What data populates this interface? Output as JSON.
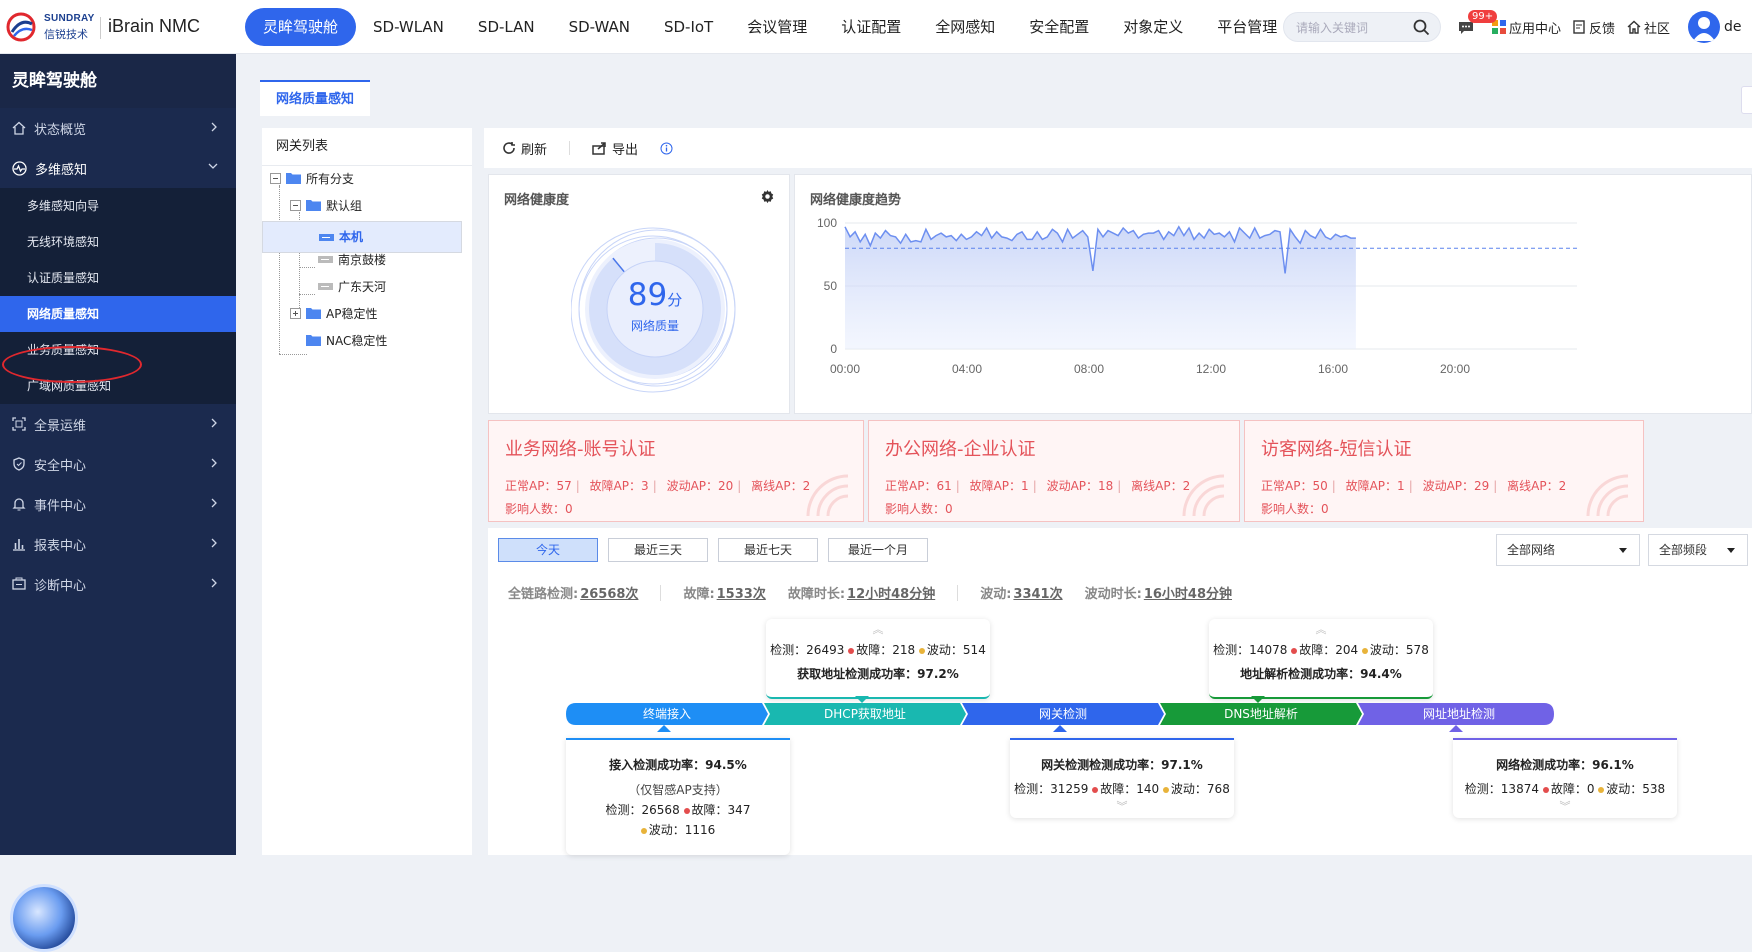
{
  "brand": {
    "en": "SUNDRAY",
    "cn": "信锐技术",
    "product": "iBrain NMC"
  },
  "nav": [
    "灵眸驾驶舱",
    "SD-WLAN",
    "SD-LAN",
    "SD-WAN",
    "SD-IoT",
    "会议管理",
    "认证配置",
    "全网感知",
    "安全配置",
    "对象定义",
    "平台管理"
  ],
  "search": {
    "placeholder": "请输入关键词"
  },
  "topright": {
    "badge": "99+",
    "app_center": "应用中心",
    "feedback": "反馈",
    "community": "社区",
    "user": "de"
  },
  "sidebar": {
    "title": "灵眸驾驶舱",
    "items": [
      {
        "label": "状态概览"
      },
      {
        "label": "多维感知",
        "subs": [
          "多维感知向导",
          "无线环境感知",
          "认证质量感知",
          "网络质量感知",
          "业务质量感知",
          "广域网质量感知"
        ]
      },
      {
        "label": "全景运维"
      },
      {
        "label": "安全中心"
      },
      {
        "label": "事件中心"
      },
      {
        "label": "报表中心"
      },
      {
        "label": "诊断中心"
      }
    ]
  },
  "tab": "网络质量感知",
  "tree": {
    "title": "网关列表",
    "nodes": [
      "所有分支",
      "默认组",
      "本机",
      "南京鼓楼",
      "广东天河",
      "AP稳定性",
      "NAC稳定性"
    ]
  },
  "toolbar": {
    "refresh": "刷新",
    "export": "导出"
  },
  "health": {
    "title": "网络健康度",
    "score": "89",
    "unit": "分",
    "label": "网络质量",
    "value": 89
  },
  "trend": {
    "title": "网络健康度趋势",
    "y_ticks": [
      "100",
      "50",
      "0"
    ],
    "x_ticks": [
      "00:00",
      "04:00",
      "08:00",
      "12:00",
      "16:00",
      "20:00"
    ]
  },
  "networks": [
    {
      "title": "业务网络-账号认证",
      "normal": "正常AP：57",
      "fault": "故障AP：3",
      "fluct": "波动AP：20",
      "offline": "离线AP：2",
      "affected": "影响人数：0"
    },
    {
      "title": "办公网络-企业认证",
      "normal": "正常AP：61",
      "fault": "故障AP：1",
      "fluct": "波动AP：18",
      "offline": "离线AP：2",
      "affected": "影响人数：0"
    },
    {
      "title": "访客网络-短信认证",
      "normal": "正常AP：50",
      "fault": "故障AP：1",
      "fluct": "波动AP：29",
      "offline": "离线AP：2",
      "affected": "影响人数：0"
    }
  ],
  "ranges": [
    "今天",
    "最近三天",
    "最近七天",
    "最近一个月"
  ],
  "filters": {
    "network": "全部网络",
    "band": "全部频段"
  },
  "summary": {
    "total_label": "全链路检测:",
    "total": "26568次",
    "fault_label": "故障:",
    "fault": "1533次",
    "fault_dur_label": "故障时长:",
    "fault_dur": "12小时48分钟",
    "fluct_label": "波动:",
    "fluct": "3341次",
    "fluct_dur_label": "波动时长:",
    "fluct_dur": "16小时48分钟"
  },
  "pipeline": [
    {
      "label": "终端接入",
      "color": "#1e8ef5"
    },
    {
      "label": "DHCP获取地址",
      "color": "#19b8b0"
    },
    {
      "label": "网关检测",
      "color": "#2f66ec"
    },
    {
      "label": "DNS地址解析",
      "color": "#179a39"
    },
    {
      "label": "网址地址检测",
      "color": "#7062e6"
    }
  ],
  "boxes": {
    "access": {
      "rate": "接入检测成功率：94.5%",
      "note": "（仅智感AP支持）",
      "detect": "检测：26568",
      "fault": "故障：347",
      "fluct": "波动：1116"
    },
    "dhcp": {
      "rate": "获取地址检测成功率：97.2%",
      "detect": "检测：26493",
      "fault": "故障：218",
      "fluct": "波动：514"
    },
    "gateway": {
      "rate": "网关检测检测成功率：97.1%",
      "detect": "检测：31259",
      "fault": "故障：140",
      "fluct": "波动：768"
    },
    "dns": {
      "rate": "地址解析检测成功率：94.4%",
      "detect": "检测：14078",
      "fault": "故障：204",
      "fluct": "波动：578"
    },
    "url": {
      "rate": "网络检测成功率：96.1%",
      "detect": "检测：13874",
      "fault": "故障：0",
      "fluct": "波动：538"
    }
  },
  "chart_data": {
    "type": "line",
    "title": "网络健康度趋势",
    "xlabel": "",
    "ylabel": "",
    "ylim": [
      0,
      100
    ],
    "x_ticks": [
      "00:00",
      "04:00",
      "08:00",
      "12:00",
      "16:00",
      "20:00"
    ],
    "threshold": 80,
    "series": [
      {
        "values": [
          97,
          89,
          93,
          85,
          91,
          82,
          92,
          88,
          94,
          90,
          89,
          84,
          91,
          85,
          86,
          85,
          95,
          87,
          90,
          92,
          89,
          90,
          86,
          91,
          87,
          89,
          93,
          90,
          96,
          88,
          93,
          89,
          88,
          86,
          91,
          93,
          87,
          87,
          93,
          87,
          89,
          95,
          92,
          85,
          95,
          88,
          91,
          94,
          89,
          62,
          95,
          89,
          94,
          92,
          90,
          96,
          92,
          94,
          88,
          91,
          92,
          92,
          94,
          87,
          93,
          90,
          97,
          90,
          96,
          87,
          92,
          88,
          95,
          91,
          92,
          89,
          93,
          85,
          96,
          92,
          88,
          96,
          88,
          90,
          91,
          94,
          93,
          60,
          95,
          89,
          84,
          94,
          90,
          88,
          95,
          89,
          87,
          91,
          89,
          90,
          88,
          88
        ]
      }
    ]
  }
}
